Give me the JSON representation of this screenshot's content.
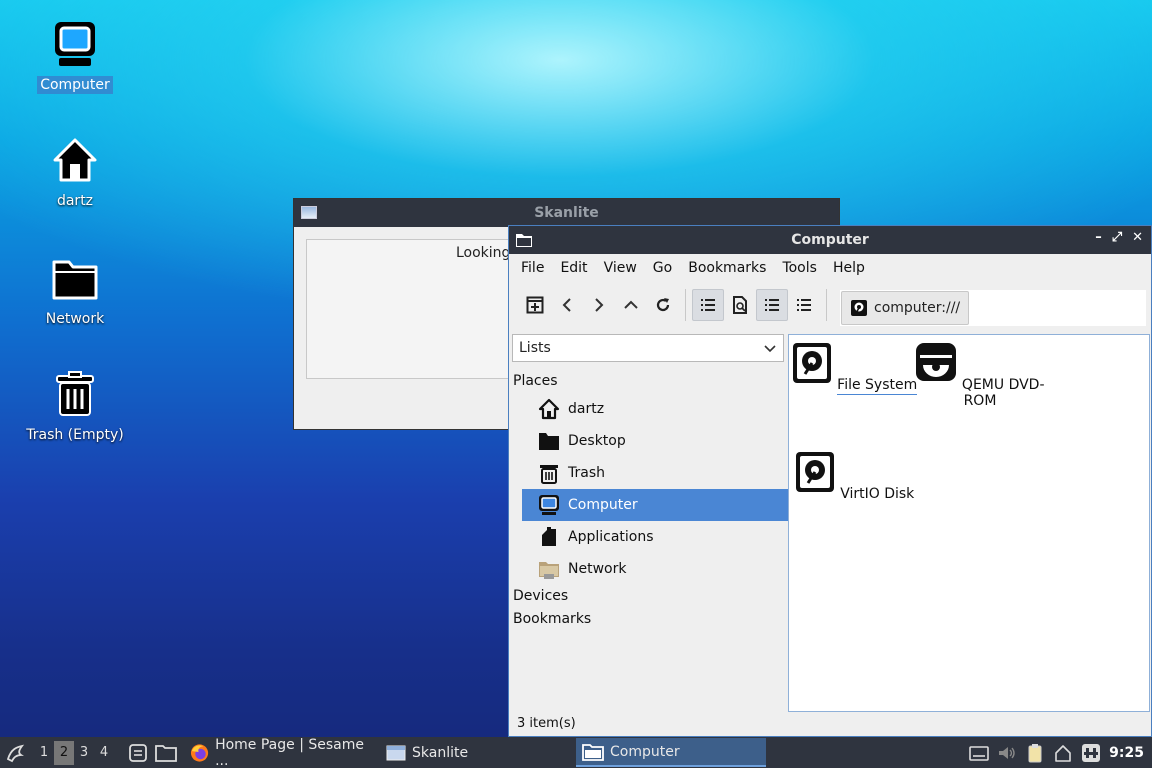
{
  "desktop": {
    "icons": [
      {
        "label": "Computer"
      },
      {
        "label": "dartz"
      },
      {
        "label": "Network"
      },
      {
        "label": "Trash (Empty)"
      }
    ]
  },
  "skanlite": {
    "title": "Skanlite",
    "message": "Looking"
  },
  "filemanager": {
    "title": "Computer",
    "menu": [
      "File",
      "Edit",
      "View",
      "Go",
      "Bookmarks",
      "Tools",
      "Help"
    ],
    "address": "computer:///",
    "side_mode": "Lists",
    "sections": {
      "places": "Places",
      "devices": "Devices",
      "bookmarks": "Bookmarks"
    },
    "places": [
      {
        "label": "dartz",
        "icon": "home-icon"
      },
      {
        "label": "Desktop",
        "icon": "folder-icon"
      },
      {
        "label": "Trash",
        "icon": "trash-icon"
      },
      {
        "label": "Computer",
        "icon": "computer-icon"
      },
      {
        "label": "Applications",
        "icon": "applications-icon"
      },
      {
        "label": "Network",
        "icon": "network-folder-icon"
      }
    ],
    "items": [
      {
        "label": "File System"
      },
      {
        "label": "QEMU DVD-ROM"
      },
      {
        "label": "VirtIO Disk"
      }
    ],
    "status": "3 item(s)"
  },
  "taskbar": {
    "workspaces": [
      "1",
      "2",
      "3",
      "4"
    ],
    "tasks": [
      {
        "label": "Home Page | Sesame ..."
      },
      {
        "label": "Skanlite"
      },
      {
        "label": "Computer"
      }
    ],
    "clock": "9:25"
  },
  "colors": {
    "accent": "#4a86d4",
    "titlebar": "#2f343f"
  }
}
